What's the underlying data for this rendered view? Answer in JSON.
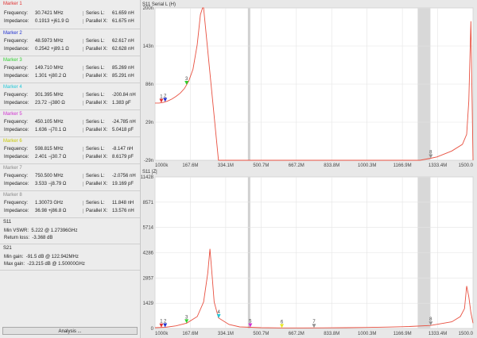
{
  "markers": [
    {
      "title": "Marker 1",
      "color": "#e03030",
      "freq_label": "Frequency:",
      "freq": "30.7421 MHz",
      "imp_label": "Impedance:",
      "imp": "0.1913 +j61.9 Ω",
      "r1_label": "Series L:",
      "r1": "61.659 nH",
      "r2_label": "Parallel X:",
      "r2": "61.675 nH"
    },
    {
      "title": "Marker 2",
      "color": "#2030d0",
      "freq_label": "Frequency:",
      "freq": "48.5973 MHz",
      "imp_label": "Impedance:",
      "imp": "0.2542 +j89.1 Ω",
      "r1_label": "Series L:",
      "r1": "62.617 nH",
      "r2_label": "Parallel X:",
      "r2": "62.628 nH"
    },
    {
      "title": "Marker 3",
      "color": "#30d030",
      "freq_label": "Frequency:",
      "freq": "149.710 MHz",
      "imp_label": "Impedance:",
      "imp": "1.301 +j80.2 Ω",
      "r1_label": "Series L:",
      "r1": "85.269 nH",
      "r2_label": "Parallel X:",
      "r2": "85.291 nH"
    },
    {
      "title": "Marker 4",
      "color": "#20c8d8",
      "freq_label": "Frequency:",
      "freq": "301.395 MHz",
      "imp_label": "Impedance:",
      "imp": "23.72 −j380 Ω",
      "r1_label": "Series L:",
      "r1": "-200.84 nH",
      "r2_label": "Parallel X:",
      "r2": "1.383 pF"
    },
    {
      "title": "Marker 5",
      "color": "#d030d0",
      "freq_label": "Frequency:",
      "freq": "450.105 MHz",
      "imp_label": "Impedance:",
      "imp": "1.636 −j70.1 Ω",
      "r1_label": "Series L:",
      "r1": "-24.785 nH",
      "r2_label": "Parallel X:",
      "r2": "5.0418 pF"
    },
    {
      "title": "Marker 6",
      "color": "#e8e820",
      "freq_label": "Frequency:",
      "freq": "598.815 MHz",
      "imp_label": "Impedance:",
      "imp": "2.401 −j30.7 Ω",
      "r1_label": "Series L:",
      "r1": "-8.147 nH",
      "r2_label": "Parallel X:",
      "r2": "8.6179 pF"
    },
    {
      "title": "Marker 7",
      "color": "#909090",
      "freq_label": "Frequency:",
      "freq": "750.500 MHz",
      "imp_label": "Impedance:",
      "imp": "3.533 −j8.79 Ω",
      "r1_label": "Series L:",
      "r1": "-2.0756 nH",
      "r2_label": "Parallel X:",
      "r2": "19.169 pF"
    },
    {
      "title": "Marker 8",
      "color": "#909090",
      "freq_label": "Frequency:",
      "freq": "1.30073 GHz",
      "imp_label": "Impedance:",
      "imp": "36.98 +j86.8 Ω",
      "r1_label": "Series L:",
      "r1": "11.848 nH",
      "r2_label": "Parallel X:",
      "r2": "13.576 nH"
    }
  ],
  "s11": {
    "title": "S11",
    "row1_label": "Min VSWR:",
    "row1": "5.222 @ 1.27396GHz",
    "row2_label": "Return loss:",
    "row2": "-3.368 dB"
  },
  "s21": {
    "title": "S21",
    "row1_label": "Min gain:",
    "row1": "-91.5 dB @ 122.942MHz",
    "row2_label": "Max gain:",
    "row2": "-23.215 dB @ 1.50000GHz"
  },
  "analysis_button": "Analysis ...",
  "colors": {
    "trace": "#e85040",
    "accent_marker_bg": "#d8d8d8"
  },
  "chart_data": [
    {
      "type": "line",
      "title": "S11 Serial L (H)",
      "x_ticks": [
        "1000k",
        "167.6M",
        "334.1M",
        "500.7M",
        "667.2M",
        "833.8M",
        "1000.3M",
        "1166.9M",
        "1333.4M",
        "1500.0"
      ],
      "y_ticks": [
        "200n",
        "143n",
        "86n",
        "29n",
        "-29n"
      ],
      "ylim": [
        -29,
        200
      ],
      "xlim": [
        1,
        1500
      ],
      "series": [
        {
          "x": [
            1,
            20,
            40,
            60,
            80,
            100,
            120,
            140,
            160,
            180,
            200,
            215,
            225,
            230,
            300,
            400,
            500,
            600,
            700,
            800,
            900,
            1000,
            1100,
            1200,
            1250,
            1300,
            1330,
            1400,
            1450,
            1470,
            1480,
            1490,
            1500
          ],
          "y": [
            57,
            57,
            58,
            60,
            63,
            67,
            72,
            79,
            90,
            108,
            145,
            190,
            200,
            200,
            -29,
            -29,
            -29,
            -29,
            -29,
            -29,
            -29,
            -29,
            -29,
            -29,
            -29,
            -26,
            -24,
            -15,
            -5,
            10,
            60,
            180,
            -29
          ]
        }
      ],
      "markers": [
        {
          "label": "1",
          "x": 30.7
        },
        {
          "label": "2",
          "x": 48.6
        },
        {
          "label": "3",
          "x": 149.7
        },
        {
          "label": "8",
          "x": 1300.7
        }
      ]
    },
    {
      "type": "line",
      "title": "S11 |Z|",
      "x_ticks": [
        "1000k",
        "167.6M",
        "334.1M",
        "500.7M",
        "667.2M",
        "833.8M",
        "1000.3M",
        "1166.9M",
        "1333.4M",
        "1500.0"
      ],
      "y_ticks": [
        "11428",
        "8571",
        "5714",
        "4286",
        "2857",
        "1429",
        "0"
      ],
      "ylim": [
        0,
        11428
      ],
      "xlim": [
        1,
        1500
      ],
      "series": [
        {
          "x": [
            1,
            50,
            100,
            150,
            200,
            230,
            250,
            260,
            270,
            280,
            300,
            350,
            400,
            500,
            600,
            700,
            800,
            900,
            1000,
            1100,
            1200,
            1300,
            1400,
            1440,
            1460,
            1470,
            1480,
            1490,
            1500
          ],
          "y": [
            60,
            90,
            200,
            400,
            900,
            2000,
            4200,
            6000,
            4000,
            2000,
            800,
            300,
            120,
            60,
            40,
            40,
            50,
            60,
            80,
            110,
            150,
            230,
            500,
            900,
            1500,
            3200,
            2400,
            1200,
            400
          ]
        }
      ],
      "markers": [
        {
          "label": "1",
          "x": 30.7
        },
        {
          "label": "2",
          "x": 48.6
        },
        {
          "label": "3",
          "x": 149.7
        },
        {
          "label": "4",
          "x": 301.4
        },
        {
          "label": "5",
          "x": 450.1
        },
        {
          "label": "6",
          "x": 598.8
        },
        {
          "label": "7",
          "x": 750.5
        },
        {
          "label": "8",
          "x": 1300.7
        }
      ]
    }
  ]
}
